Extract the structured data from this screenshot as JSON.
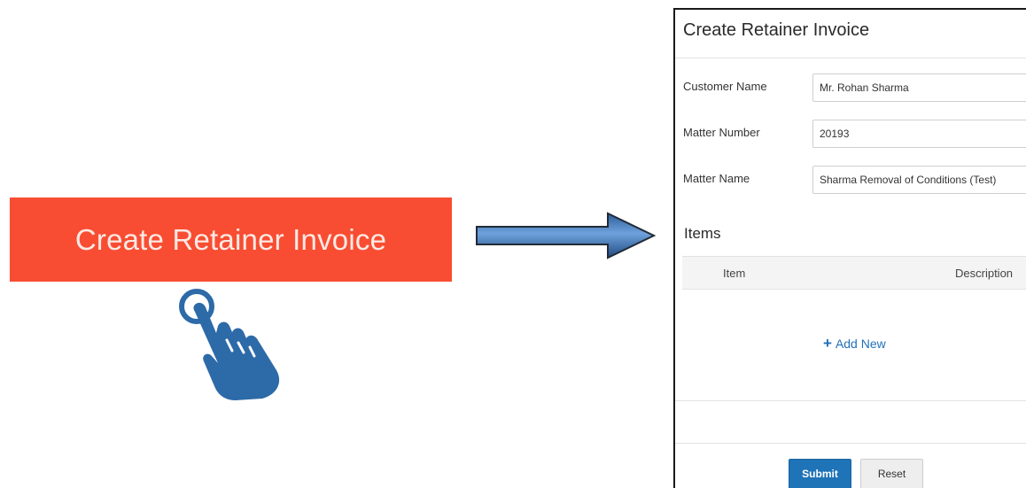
{
  "cta_button": {
    "label": "Create Retainer Invoice"
  },
  "icons": {
    "pointer": "tap-hand-icon",
    "arrow": "right-arrow-icon",
    "add": "plus-icon"
  },
  "dialog": {
    "title": "Create Retainer Invoice",
    "fields": [
      {
        "label": "Customer Name",
        "value": "Mr. Rohan Sharma"
      },
      {
        "label": "Matter Number",
        "value": "20193"
      },
      {
        "label": "Matter Name",
        "value": "Sharma Removal of Conditions (Test)"
      }
    ],
    "items": {
      "title": "Items",
      "columns": [
        "Item",
        "Description"
      ],
      "add_new_label": "Add New"
    },
    "actions": {
      "submit_label": "Submit",
      "reset_label": "Reset"
    }
  },
  "colors": {
    "cta_background": "#f84d32",
    "hand": "#2d6aa8",
    "primary": "#1f73b7",
    "link": "#1f70b8"
  }
}
